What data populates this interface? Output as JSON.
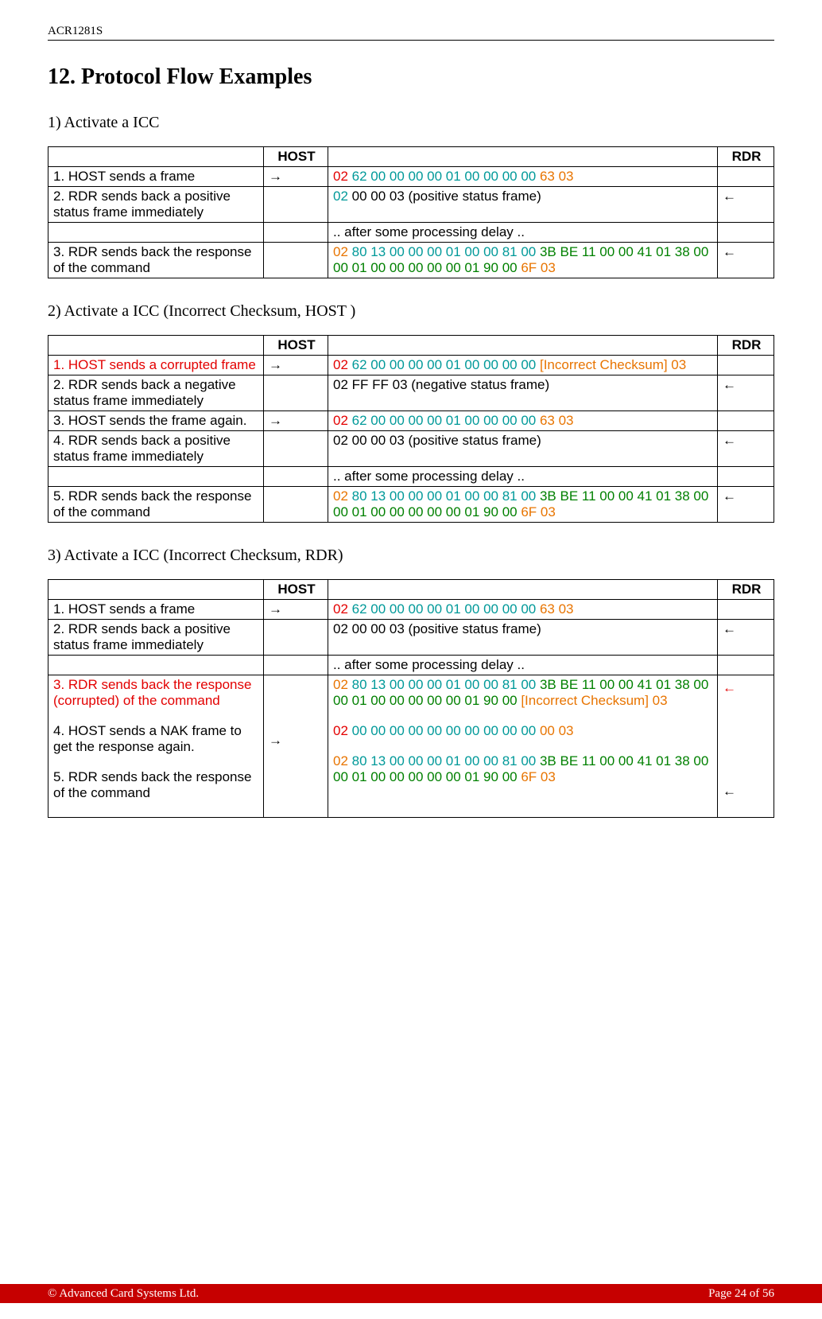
{
  "header": {
    "device_id": "ACR1281S"
  },
  "section": {
    "title": "12. Protocol Flow Examples"
  },
  "arrows": {
    "right": "→",
    "left": "←"
  },
  "table_headers": {
    "host": "HOST",
    "rdr": "RDR"
  },
  "sub1": {
    "title": "1) Activate a ICC",
    "rows": [
      {
        "desc": "1. HOST sends a frame",
        "host_arrow": true,
        "data": [
          {
            "t": "02 ",
            "c": "c-red"
          },
          {
            "t": "62 00 00 00 00 01 00 00 00 00 ",
            "c": "c-teal"
          },
          {
            "t": "63 03",
            "c": "c-orange"
          }
        ]
      },
      {
        "desc": "2. RDR sends back a positive status frame immediately",
        "rdr_arrow": true,
        "data": [
          {
            "t": "02 ",
            "c": "c-teal"
          },
          {
            "t": "00 00 03 (positive status frame)",
            "c": "c-black"
          }
        ]
      },
      {
        "desc": "",
        "data": [
          {
            "t": ".. after some processing delay ..",
            "c": "c-black"
          }
        ]
      },
      {
        "desc": "3. RDR sends back the response of the command",
        "rdr_arrow": true,
        "data": [
          {
            "t": "02 ",
            "c": "c-orange"
          },
          {
            "t": "80 13 00 00 00 01 00 00 81 00 ",
            "c": "c-teal"
          },
          {
            "t": "3B BE 11 00 00 41 01 38 00 00 01 00 00 00 00 00 01 90 00 ",
            "c": "c-green"
          },
          {
            "t": "6F 03",
            "c": "c-orange"
          }
        ]
      }
    ]
  },
  "sub2": {
    "title": "2) Activate a ICC (Incorrect Checksum, HOST )",
    "rows": [
      {
        "desc": "1. HOST sends a corrupted frame",
        "desc_class": "c-red",
        "host_arrow": true,
        "data": [
          {
            "t": "02 ",
            "c": "c-red"
          },
          {
            "t": "62 00 00 00 00 01 00 00 00 00  ",
            "c": "c-teal"
          },
          {
            "t": "[Incorrect Checksum] 03",
            "c": "c-orange"
          }
        ]
      },
      {
        "desc": "2. RDR sends back a negative status frame immediately",
        "rdr_arrow": true,
        "data": [
          {
            "t": "02 FF FF 03 (negative status frame)",
            "c": "c-black"
          }
        ]
      },
      {
        "desc": "3. HOST sends the frame again.",
        "host_arrow": true,
        "data": [
          {
            "t": "02 ",
            "c": "c-red"
          },
          {
            "t": "62 00 00 00 00 01 00 00 00 00  ",
            "c": "c-teal"
          },
          {
            "t": "63 03",
            "c": "c-orange"
          }
        ]
      },
      {
        "desc": "4. RDR sends back a positive status frame immediately",
        "rdr_arrow": true,
        "data": [
          {
            "t": "02 00 00 03 (positive status frame)",
            "c": "c-black"
          }
        ]
      },
      {
        "desc": "",
        "data": [
          {
            "t": ".. after some processing delay ..",
            "c": "c-black"
          }
        ]
      },
      {
        "desc": "5. RDR sends back the response of the command",
        "rdr_arrow": true,
        "data": [
          {
            "t": "02 ",
            "c": "c-orange"
          },
          {
            "t": "80 13 00 00 00 01 00 00 81 00 ",
            "c": "c-teal"
          },
          {
            "t": "3B BE 11 00 00 41 01 38 00 00 01 00 00 00 00 00 01 90 00 ",
            "c": "c-green"
          },
          {
            "t": "6F 03",
            "c": "c-orange"
          }
        ]
      }
    ]
  },
  "sub3": {
    "title": "3) Activate a ICC (Incorrect Checksum, RDR)",
    "rows": [
      {
        "desc": "1. HOST sends a frame",
        "host_arrow": true,
        "data": [
          {
            "t": "02 ",
            "c": "c-red"
          },
          {
            "t": "62 00 00 00 00 01 00 00 00 00 ",
            "c": "c-teal"
          },
          {
            "t": "63 03",
            "c": "c-orange"
          }
        ]
      },
      {
        "desc": "2. RDR sends back a positive status frame immediately",
        "rdr_arrow": true,
        "data": [
          {
            "t": "02 00 00 03 (positive status frame)",
            "c": "c-black"
          }
        ]
      },
      {
        "desc": "",
        "data": [
          {
            "t": ".. after some processing delay ..",
            "c": "c-black"
          }
        ]
      }
    ],
    "bigrow": {
      "desc_parts": [
        {
          "t": "3. RDR sends back the response (corrupted) of the command",
          "c": "c-red"
        },
        {
          "t": "4. HOST sends a NAK frame to get the response again.",
          "c": "c-black"
        },
        {
          "t": "5. RDR sends back the response of the command",
          "c": "c-black"
        }
      ],
      "host_arrow_label": "→",
      "rdr_arrows": [
        "←",
        "←"
      ],
      "data_blocks": [
        [
          {
            "t": "02 ",
            "c": "c-orange"
          },
          {
            "t": "80 13 00 00 00 01 00 00 81 00 ",
            "c": "c-teal"
          },
          {
            "t": "3B BE 11 00 00 41 01 38 00 00 01 00 00 00 00 00 01 90 00 ",
            "c": "c-green"
          },
          {
            "t": "[Incorrect Checksum] 03",
            "c": "c-orange"
          }
        ],
        [
          {
            "t": "02 ",
            "c": "c-red"
          },
          {
            "t": "00 00 00 00 00 00 00 00 00 00 ",
            "c": "c-teal"
          },
          {
            "t": "00 03",
            "c": "c-orange"
          }
        ],
        [
          {
            "t": "02 ",
            "c": "c-orange"
          },
          {
            "t": "80 13 00 00 00 01 00 00 81 00 ",
            "c": "c-teal"
          },
          {
            "t": "3B BE 11 00 00 41 01 38 00 00 01 00 00 00 00 00 01 90 00 ",
            "c": "c-green"
          },
          {
            "t": "6F 03",
            "c": "c-orange"
          }
        ]
      ]
    }
  },
  "footer": {
    "copyright": "© Advanced Card Systems Ltd.",
    "page": "Page 24 of 56"
  }
}
